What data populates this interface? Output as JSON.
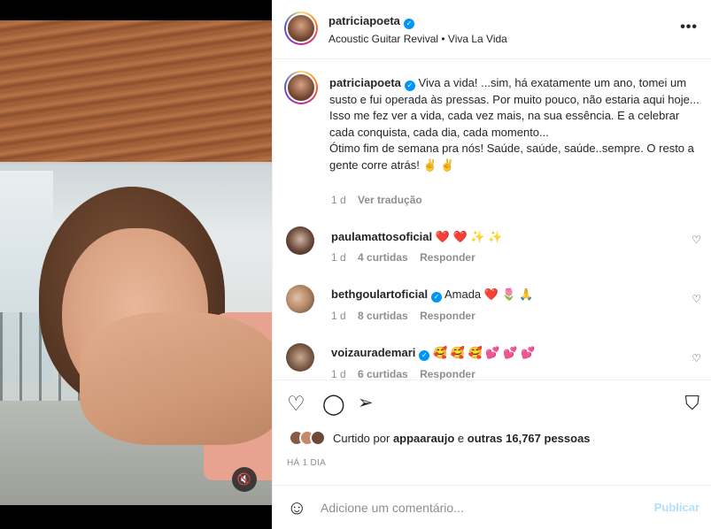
{
  "post": {
    "username": "patriciapoeta",
    "verified_icon": "verified-badge-icon",
    "subtitle": "Acoustic Guitar Revival • Viva La Vida",
    "more_icon": "•••"
  },
  "caption": {
    "username": "patriciapoeta",
    "text": "Viva a vida! ...sim, há exatamente um ano, tomei um susto e fui operada às pressas. Por muito pouco, não estaria aqui hoje...\nIsso me fez ver a vida, cada vez mais, na sua essência. E a celebrar cada conquista, cada dia, cada momento...\nÓtimo fim de semana pra nós! Saúde, saúde, saúde..sempre. O resto a gente corre atrás! ✌️ ✌️",
    "age": "1 d",
    "translate": "Ver tradução"
  },
  "comments": [
    {
      "username": "paulamattosoficial",
      "verified": false,
      "text": "❤️ ❤️ ✨ ✨",
      "age": "1 d",
      "likes": "4 curtidas",
      "reply": "Responder"
    },
    {
      "username": "bethgoulartoficial",
      "verified": true,
      "text": "Amada ❤️ 🌷 🙏",
      "age": "1 d",
      "likes": "8 curtidas",
      "reply": "Responder"
    },
    {
      "username": "voizaurademari",
      "verified": true,
      "text": "🥰 🥰 🥰 💕 💕 💕",
      "age": "1 d",
      "likes": "6 curtidas",
      "reply": "Responder"
    }
  ],
  "actions": {
    "like_icon": "♡",
    "comment_icon": "◯",
    "share_icon": "➢",
    "save_icon": "⛉"
  },
  "likes": {
    "prefix": "Curtido por",
    "user": "appaaraujo",
    "joiner": "e",
    "others": "outras 16,767 pessoas"
  },
  "timestamp": "HÁ 1 DIA",
  "add_comment": {
    "placeholder": "Adicione um comentário...",
    "publish": "Publicar",
    "emoji_icon": "☺"
  },
  "media": {
    "mute_icon": "🔇"
  },
  "colors": {
    "accent": "#0095f6",
    "publish_disabled": "#b2dffc",
    "heart": "#ed4956"
  }
}
